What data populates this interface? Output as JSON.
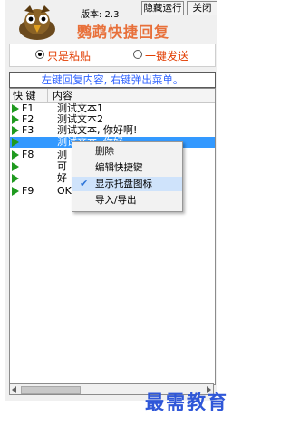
{
  "header": {
    "version_label": "版本: 2.3",
    "app_title": "鹦鹉快捷回复",
    "hide_button": "隐藏运行",
    "close_button": "关闭"
  },
  "mode": {
    "options": [
      {
        "label": "只是粘贴",
        "selected": true
      },
      {
        "label": "一键发送",
        "selected": false
      }
    ]
  },
  "hint": "左键回复内容, 右键弹出菜单。",
  "list": {
    "columns": [
      "快 键",
      "内容"
    ],
    "rows": [
      {
        "key": "F1",
        "content": "测试文本1",
        "arrow": true,
        "selected": false
      },
      {
        "key": "F2",
        "content": "测试文本2",
        "arrow": true,
        "selected": false
      },
      {
        "key": "F3",
        "content": "测试文本, 你好啊!",
        "arrow": true,
        "selected": false
      },
      {
        "key": "",
        "content": "测试文本, 你好",
        "arrow": true,
        "selected": true
      },
      {
        "key": "F8",
        "content": "测",
        "arrow": true,
        "selected": false
      },
      {
        "key": "",
        "content": "可",
        "arrow": true,
        "selected": false
      },
      {
        "key": "",
        "content": "好",
        "arrow": true,
        "selected": false
      },
      {
        "key": "F9",
        "content": "OK",
        "arrow": true,
        "selected": false
      }
    ]
  },
  "context_menu": {
    "items": [
      {
        "label": "删除",
        "checked": false
      },
      {
        "label": "编辑快捷键",
        "checked": false
      },
      {
        "label": "显示托盘图标",
        "checked": true
      },
      {
        "label": "导入/导出",
        "checked": false
      }
    ]
  },
  "watermark": "最需教育",
  "colors": {
    "title": "#e8703a",
    "radio_label": "#e23c00",
    "hint": "#2f62ff",
    "selection": "#3399ff",
    "arrow": "#1f9a1f",
    "watermark": "#2f57d8"
  }
}
